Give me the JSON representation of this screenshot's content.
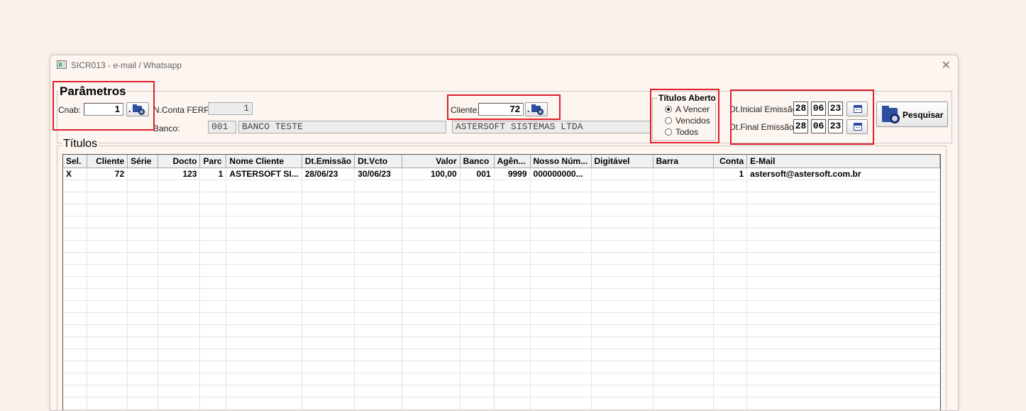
{
  "window": {
    "title": "SICR013 - e-mail / Whatsapp"
  },
  "params": {
    "title": "Parâmetros",
    "cnab_label": "Cnab:",
    "cnab_value": "1",
    "nconta_label": "N.Conta FERP:",
    "nconta_value": "1",
    "banco_label": "Banco:",
    "banco_code": "001",
    "banco_name": "BANCO TESTE",
    "cliente_label": "Cliente:",
    "cliente_value": "72",
    "cliente_name": "ASTERSOFT SISTEMAS LTDA",
    "titulos_aberto": {
      "title": "Títulos Aberto",
      "options": [
        "A Vencer",
        "Vencidos",
        "Todos"
      ],
      "selected": "A Vencer"
    },
    "dt_inicial_label": "Dt.Inicial Emissão:",
    "dt_inicial": {
      "day": "28",
      "month": "06",
      "year": "23"
    },
    "dt_final_label": "Dt.Final Emissão:",
    "dt_final": {
      "day": "28",
      "month": "06",
      "year": "23"
    },
    "pesquisar_label": "Pesquisar"
  },
  "titulos": {
    "title": "Títulos",
    "columns": [
      "Sel.",
      "Cliente",
      "Série",
      "Docto",
      "Parc",
      "Nome Cliente",
      "Dt.Emissão",
      "Dt.Vcto",
      "Valor",
      "Banco",
      "Agên...",
      "Nosso Núm...",
      "Digitável",
      "Barra",
      "Conta",
      "E-Mail"
    ],
    "rows": [
      [
        "X",
        "72",
        "",
        "123",
        "1",
        "ASTERSOFT SI...",
        "28/06/23",
        "30/06/23",
        "100,00",
        "001",
        "9999",
        "000000000...",
        "",
        "",
        "1",
        "astersoft@astersoft.com.br"
      ]
    ]
  },
  "icons": {
    "app": "app-window-icon",
    "close": "close-icon",
    "lookup": "folder-search-icon",
    "calendar": "calendar-icon"
  },
  "colors": {
    "highlight": "#e0202a",
    "background": "#fbf1ec",
    "icon_blue": "#2d4fa0"
  }
}
